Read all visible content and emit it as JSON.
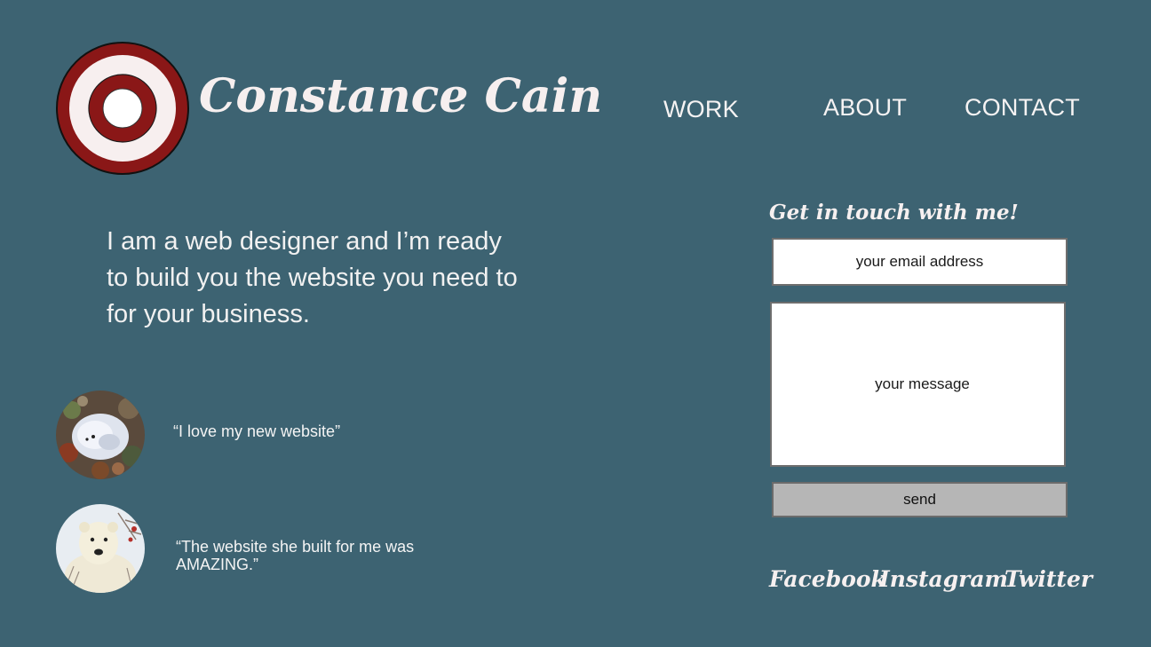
{
  "brand": {
    "name": "Constance Cain"
  },
  "nav": {
    "work": "WORK",
    "about": "ABOUT",
    "contact": "CONTACT"
  },
  "intro": {
    "text": "I am a web designer and I’m ready to build you the website you need to for your business."
  },
  "testimonials": [
    {
      "quote": "“I love my new website”",
      "avatar": "arctic-fox-avatar"
    },
    {
      "quote": "“The website she built for me was AMAZING.”",
      "avatar": "polar-bear-avatar"
    }
  ],
  "contact": {
    "title": "Get in touch with me!",
    "email_placeholder": "your email address",
    "message_placeholder": "your message",
    "send_label": "send"
  },
  "social": {
    "facebook": "Facebook",
    "instagram": "Instagram",
    "twitter": "Twitter"
  },
  "colors": {
    "background": "#3d6372",
    "logo_red": "#8a1717",
    "logo_white": "#f7efef",
    "send_button": "#b6b6b6"
  }
}
